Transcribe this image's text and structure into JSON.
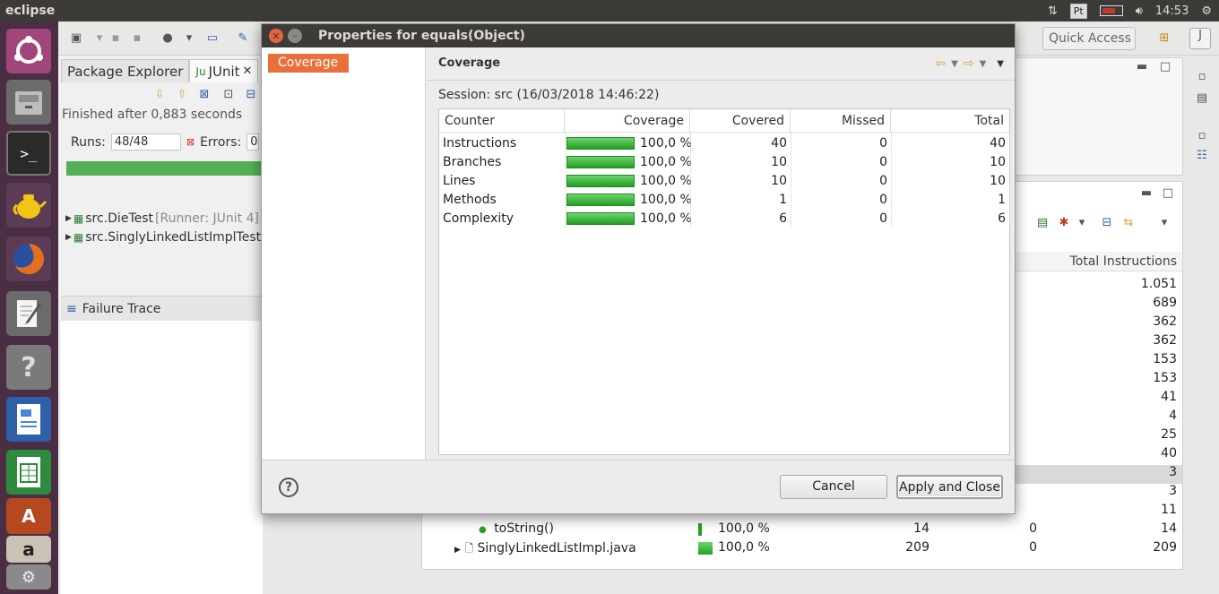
{
  "topbar": {
    "app_name": "eclipse",
    "keyboard_layout": "Pt",
    "clock": "14:53"
  },
  "toolbar": {
    "quick_access": "Quick Access"
  },
  "left_panel": {
    "tabs": [
      "Package Explorer",
      "JUnit"
    ],
    "status": "Finished after 0,883 seconds",
    "runs_label": "Runs:",
    "runs_value": "48/48",
    "errors_label": "Errors:",
    "errors_value": "0",
    "progress": 1.0,
    "tree": [
      {
        "name": "src.DieTest",
        "detail": "[Runner: JUnit 4]"
      },
      {
        "name": "src.SinglyLinkedListImplTest",
        "detail": ""
      }
    ],
    "failure_trace": "Failure Trace"
  },
  "coverage_view": {
    "column_header": "Total Instructions",
    "values": [
      "1.051",
      "689",
      "362",
      "362",
      "153",
      "153",
      "41",
      "4",
      "25",
      "40",
      "3",
      "3",
      "11",
      "14",
      "209"
    ],
    "selected_index": 9,
    "rows": [
      {
        "name": "toString()",
        "coverage": "100,0 %",
        "covered": "14",
        "missed": "0"
      },
      {
        "name": "SinglyLinkedListImpl.java",
        "coverage": "100,0 %",
        "covered": "209",
        "missed": "0"
      }
    ]
  },
  "dialog": {
    "title": "Properties for equals(Object)",
    "nav_items": [
      "Coverage"
    ],
    "page_title": "Coverage",
    "session": "Session: src (16/03/2018 14:46:22)",
    "columns": [
      "Counter",
      "Coverage",
      "Covered",
      "Missed",
      "Total"
    ],
    "rows": [
      {
        "counter": "Instructions",
        "coverage": "100,0 %",
        "covered": "40",
        "missed": "0",
        "total": "40"
      },
      {
        "counter": "Branches",
        "coverage": "100,0 %",
        "covered": "10",
        "missed": "0",
        "total": "10"
      },
      {
        "counter": "Lines",
        "coverage": "100,0 %",
        "covered": "10",
        "missed": "0",
        "total": "10"
      },
      {
        "counter": "Methods",
        "coverage": "100,0 %",
        "covered": "1",
        "missed": "0",
        "total": "1"
      },
      {
        "counter": "Complexity",
        "coverage": "100,0 %",
        "covered": "6",
        "missed": "0",
        "total": "6"
      }
    ],
    "help": "?",
    "cancel": "Cancel",
    "apply_close": "Apply and Close"
  },
  "colors": {
    "accent": "#e9703b",
    "progress_green": "#54b054",
    "titlebar": "#3c3b37",
    "launcher": "#4a2e43"
  }
}
